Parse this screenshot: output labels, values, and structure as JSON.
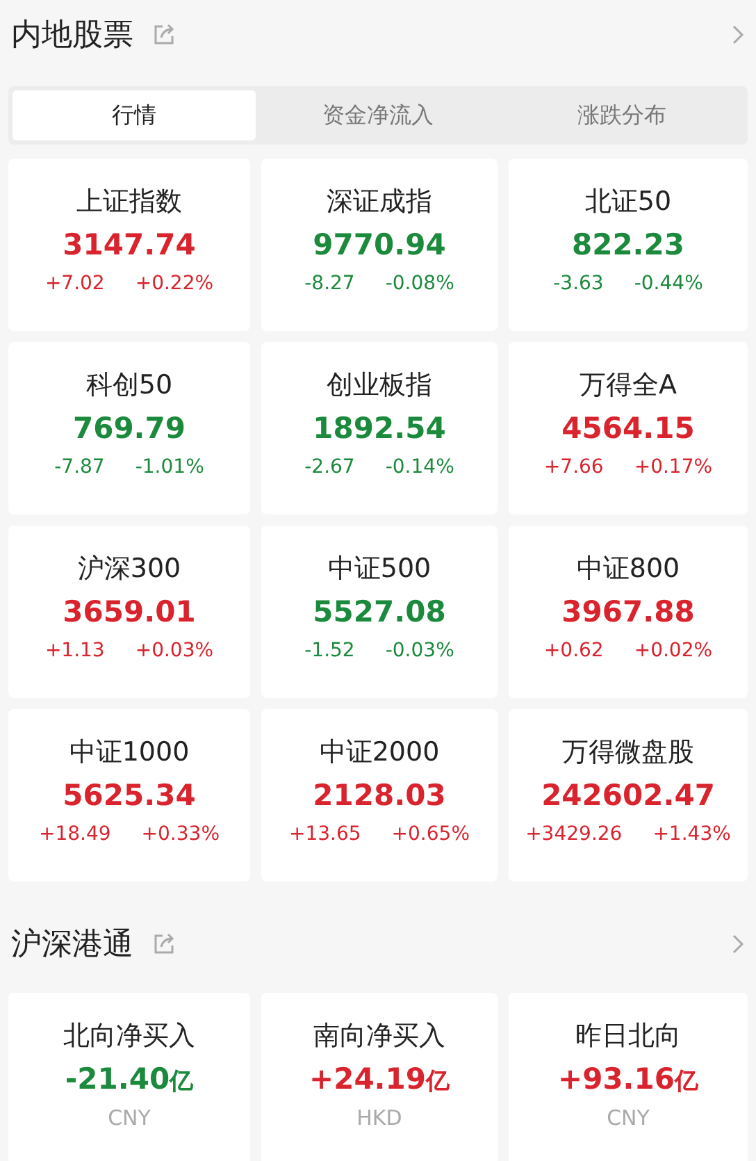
{
  "sections": [
    {
      "title": "内地股票",
      "tabs": [
        {
          "label": "行情",
          "selected": true
        },
        {
          "label": "资金净流入",
          "selected": false
        },
        {
          "label": "涨跌分布",
          "selected": false
        }
      ],
      "cards": [
        {
          "name": "上证指数",
          "value": "3147.74",
          "change": "+7.02",
          "percent": "+0.22%",
          "color": "#d9232d"
        },
        {
          "name": "深证成指",
          "value": "9770.94",
          "change": "-8.27",
          "percent": "-0.08%",
          "color": "#1c8a3c"
        },
        {
          "name": "北证50",
          "value": "822.23",
          "change": "-3.63",
          "percent": "-0.44%",
          "color": "#1c8a3c"
        },
        {
          "name": "科创50",
          "value": "769.79",
          "change": "-7.87",
          "percent": "-1.01%",
          "color": "#1c8a3c"
        },
        {
          "name": "创业板指",
          "value": "1892.54",
          "change": "-2.67",
          "percent": "-0.14%",
          "color": "#1c8a3c"
        },
        {
          "name": "万得全A",
          "value": "4564.15",
          "change": "+7.66",
          "percent": "+0.17%",
          "color": "#d9232d"
        },
        {
          "name": "沪深300",
          "value": "3659.01",
          "change": "+1.13",
          "percent": "+0.03%",
          "color": "#d9232d"
        },
        {
          "name": "中证500",
          "value": "5527.08",
          "change": "-1.52",
          "percent": "-0.03%",
          "color": "#1c8a3c"
        },
        {
          "name": "中证800",
          "value": "3967.88",
          "change": "+0.62",
          "percent": "+0.02%",
          "color": "#d9232d"
        },
        {
          "name": "中证1000",
          "value": "5625.34",
          "change": "+18.49",
          "percent": "+0.33%",
          "color": "#d9232d"
        },
        {
          "name": "中证2000",
          "value": "2128.03",
          "change": "+13.65",
          "percent": "+0.65%",
          "color": "#d9232d"
        },
        {
          "name": "万得微盘股",
          "value": "242602.47",
          "change": "+3429.26",
          "percent": "+1.43%",
          "color": "#d9232d"
        }
      ]
    },
    {
      "title": "沪深港通",
      "cards": [
        {
          "name": "北向净买入",
          "value": "-21.40",
          "unit": "亿",
          "currency": "CNY",
          "color": "#1c8a3c"
        },
        {
          "name": "南向净买入",
          "value": "+24.19",
          "unit": "亿",
          "currency": "HKD",
          "color": "#d9232d"
        },
        {
          "name": "昨日北向",
          "value": "+93.16",
          "unit": "亿",
          "currency": "CNY",
          "color": "#d9232d"
        }
      ]
    }
  ]
}
